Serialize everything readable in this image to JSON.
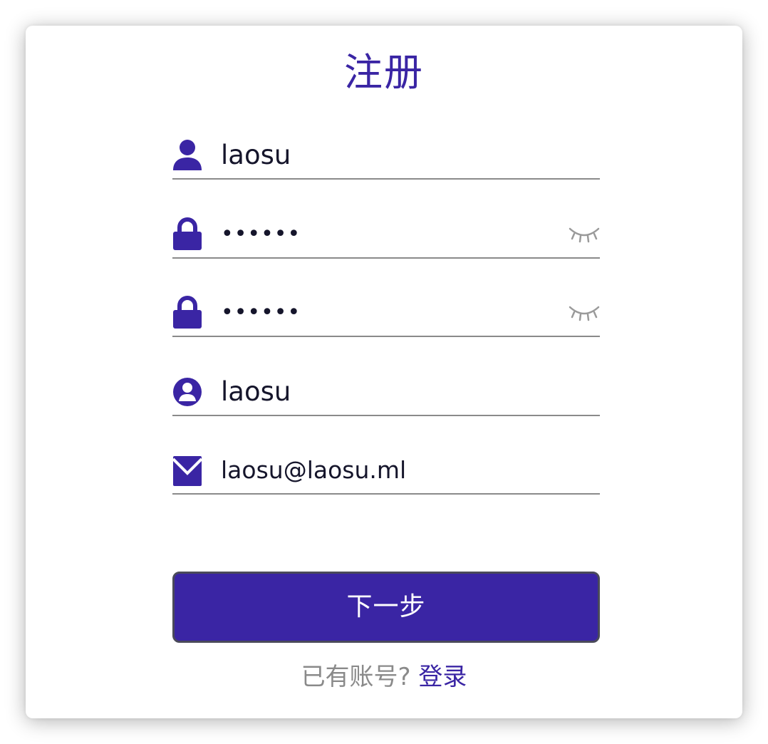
{
  "page": {
    "title": "注册"
  },
  "form": {
    "username": {
      "value": "laosu",
      "icon": "user-icon"
    },
    "password": {
      "value": "••••••",
      "icon": "lock-icon",
      "toggle_icon": "eye-closed-icon"
    },
    "confirm_password": {
      "value": "••••••",
      "icon": "lock-icon",
      "toggle_icon": "eye-closed-icon"
    },
    "nickname": {
      "value": "laosu",
      "icon": "user-circle-icon"
    },
    "email": {
      "value": "laosu@laosu.ml",
      "icon": "mail-icon"
    }
  },
  "actions": {
    "next_label": "下一步"
  },
  "footer": {
    "prompt": "已有账号?",
    "login_label": "登录"
  },
  "colors": {
    "accent": "#3a25a4",
    "underline": "#8a8a8a",
    "muted_text": "#8a8a8a",
    "input_text": "#15152b"
  }
}
